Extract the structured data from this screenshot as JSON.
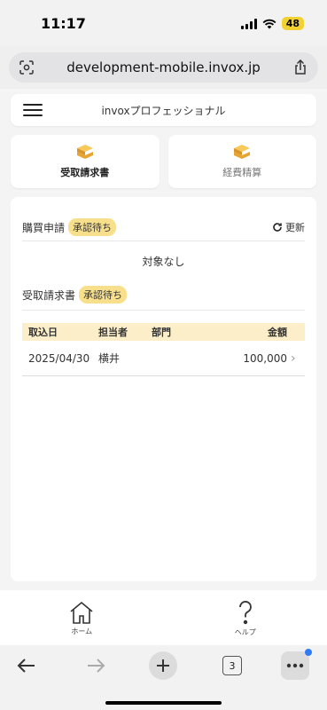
{
  "status_bar": {
    "time": "11:17",
    "battery": "48"
  },
  "browser": {
    "url": "development-mobile.invox.jp",
    "tab_count": "3"
  },
  "header": {
    "title": "invoxプロフェッショナル"
  },
  "tiles": [
    {
      "label": "受取請求書",
      "active": true
    },
    {
      "label": "経費精算",
      "active": false
    }
  ],
  "purchase_request": {
    "title": "購買申請",
    "badge": "承認待ち",
    "refresh_label": "更新",
    "empty_text": "対象なし"
  },
  "received_invoices": {
    "title": "受取請求書",
    "badge": "承認待ち",
    "columns": {
      "date": "取込日",
      "person": "担当者",
      "dept": "部門",
      "amount": "金額"
    },
    "rows": [
      {
        "date": "2025/04/30",
        "person": "横井",
        "dept": "",
        "amount": "100,000"
      }
    ]
  },
  "bottom_nav": {
    "home_label": "ホーム",
    "help_label": "ヘルプ"
  },
  "colors": {
    "accent": "#f2b93b",
    "badge_bg": "#f7df8c",
    "table_header_bg": "#fbeec9"
  }
}
